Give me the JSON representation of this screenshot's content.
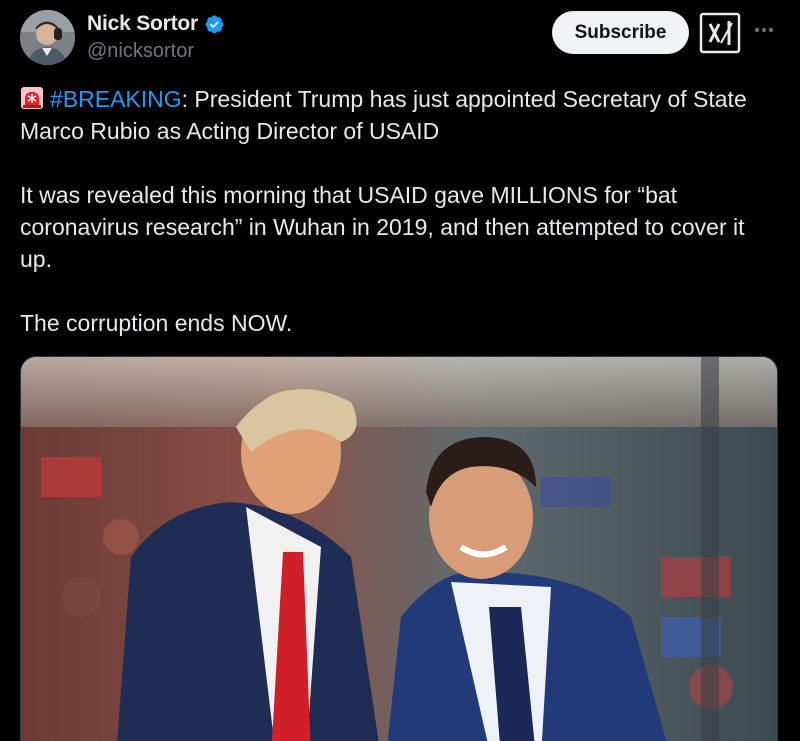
{
  "author": {
    "display_name": "Nick Sortor",
    "handle": "@nicksortor",
    "verified_icon": "verified-badge-icon",
    "avatar": "profile-avatar"
  },
  "actions": {
    "subscribe_label": "Subscribe",
    "grok_icon": "grok-icon",
    "more_icon": "more-options-icon"
  },
  "tweet": {
    "emoji": "siren-icon",
    "hashtag": "#BREAKING",
    "line1_rest": ": President Trump has just appointed Secretary of State Marco Rubio as Acting Director of USAID",
    "paragraph2": "It was revealed this morning that USAID gave MILLIONS for “bat coronavirus research” in Wuhan in 2019, and then attempted to cover it up.",
    "paragraph3": "The corruption ends NOW."
  },
  "media": {
    "kind": "photo"
  },
  "colors": {
    "background": "#000000",
    "text": "#e7e9ea",
    "secondary_text": "#71767b",
    "link": "#1d9bf0",
    "verified": "#1d9bf0"
  }
}
